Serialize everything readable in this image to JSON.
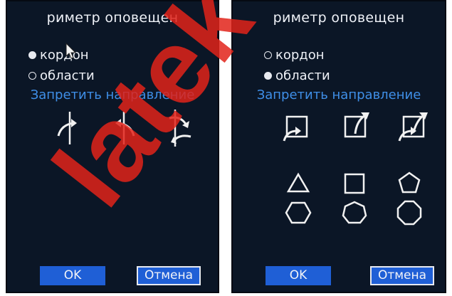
{
  "left_panel": {
    "title": "риметр оповещен",
    "radio_cordon": "кордон",
    "radio_area": "области",
    "section_label": "Запретить направление",
    "ok_label": "OK",
    "cancel_label": "Отмена",
    "selected": "кордон",
    "direction_icons": [
      "line-arrow-left-icon",
      "line-arrow-right-icon",
      "line-arrow-both-icon"
    ]
  },
  "right_panel": {
    "title": "риметр оповещен",
    "radio_cordon": "кордон",
    "radio_area": "области",
    "section_label": "Запретить направление",
    "ok_label": "OK",
    "cancel_label": "Отмена",
    "selected": "области",
    "direction_icons": [
      "box-arrow-in-icon",
      "box-arrow-out-icon",
      "box-arrow-both-icon"
    ],
    "shape_icons": [
      "triangle-icon",
      "square-icon",
      "pentagon-icon",
      "hexagon-icon",
      "heptagon-icon",
      "octagon-icon"
    ]
  },
  "watermark_text": "latek",
  "colors": {
    "panel_bg": "#0b1626",
    "accent_blue": "#3f8fe8",
    "button_blue": "#1f5fd6",
    "watermark_red": "#e2231a"
  }
}
